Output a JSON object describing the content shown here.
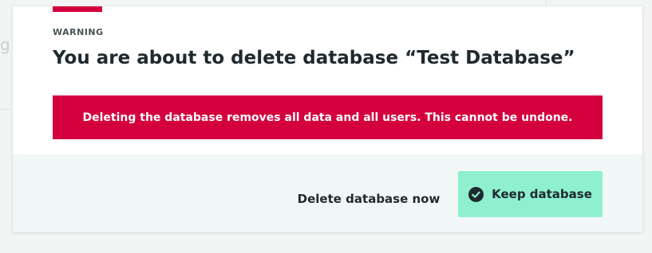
{
  "background": {
    "ghost_text": "g"
  },
  "dialog": {
    "eyebrow": "WARNING",
    "title": "You are about to delete database “Test Database”",
    "alert_message": "Deleting the database removes all data and all users. This cannot be undone.",
    "secondary_action_label": "Delete database now",
    "primary_action_label": "Keep database",
    "primary_action_icon": "check-circle-icon"
  },
  "colors": {
    "danger": "#d4003d",
    "primary_button": "#8ef0cf",
    "footer_background": "#f1f6f6",
    "text": "#1f2a2e"
  }
}
